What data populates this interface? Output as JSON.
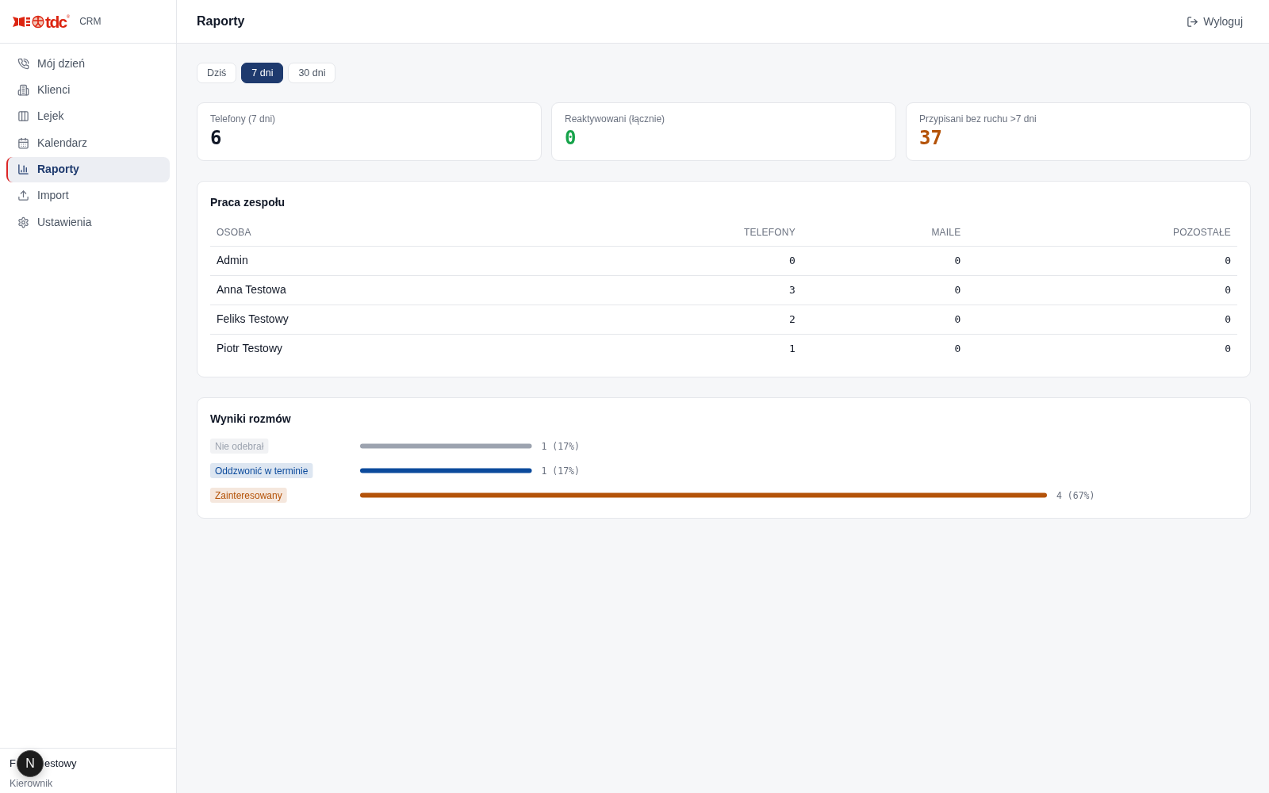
{
  "sidebar": {
    "brand": {
      "logo_text": "tdc$^{®}$",
      "app_name": "CRM"
    },
    "items": [
      {
        "label": "Mój dzień",
        "selected": false
      },
      {
        "label": "Klienci",
        "selected": false
      },
      {
        "label": "Lejek",
        "selected": false
      },
      {
        "label": "Kalendarz",
        "selected": false
      },
      {
        "label": "Raporty",
        "selected": true
      },
      {
        "label": "Import",
        "selected": false
      },
      {
        "label": "Ustawienia",
        "selected": false
      }
    ],
    "user": {
      "name_parts": [
        "F",
        "estowy"
      ],
      "overlay_button": "N",
      "role": "Kierownik"
    }
  },
  "header": {
    "title": "Raporty",
    "logout": "Wyloguj"
  },
  "period_tabs": [
    {
      "label": "Dziś",
      "selected": false
    },
    {
      "label": "7 dni",
      "selected": true
    },
    {
      "label": "30 dni",
      "selected": false
    }
  ],
  "stats": [
    {
      "label": "Telefony (7 dni)",
      "value": "6",
      "color": "#111827"
    },
    {
      "label": "Reaktywowani (łącznie)",
      "value": "0",
      "color": "#16a34a"
    },
    {
      "label": "Przypisani bez ruchu >7 dni",
      "value": "37",
      "color": "#b45309"
    }
  ],
  "team_work": {
    "title": "Praca zespołu",
    "columns": [
      "OSOBA",
      "TELEFONY",
      "MAILE",
      "POZOSTAŁE"
    ],
    "rows": [
      [
        "Admin",
        "0",
        "0",
        "0"
      ],
      [
        "Anna Testowa",
        "3",
        "0",
        "0"
      ],
      [
        "Feliks Testowy",
        "2",
        "0",
        "0"
      ],
      [
        "Piotr Testowy",
        "1",
        "0",
        "0"
      ]
    ]
  },
  "call_results": {
    "title": "Wyniki rozmów",
    "chart_data": {
      "type": "bar",
      "orientation": "horizontal",
      "categories": [
        "Nie odebrał",
        "Oddzwonić w terminie",
        "Zainteresowany"
      ],
      "colors": [
        "#9ca3af",
        "#0b4a9c",
        "#b45309"
      ],
      "values": [
        1,
        1,
        4
      ],
      "value_labels": [
        "1 (17%)",
        "1 (17%)",
        "4 (67%)"
      ]
    }
  }
}
